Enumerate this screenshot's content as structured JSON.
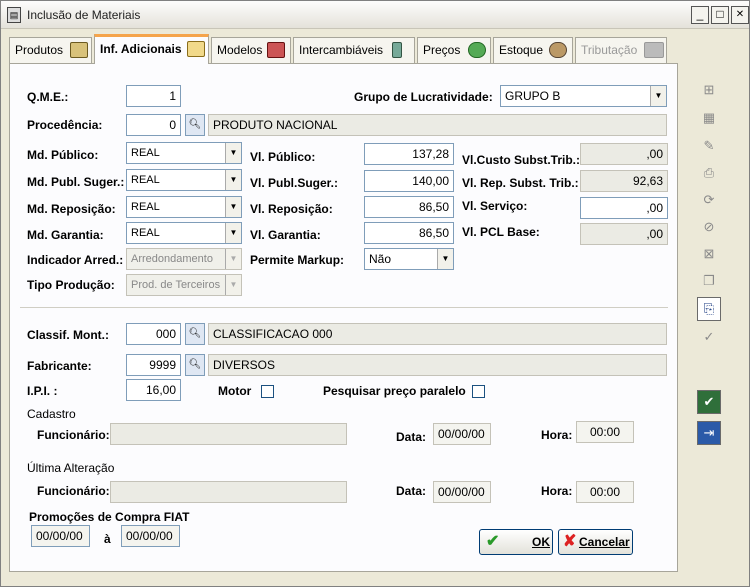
{
  "window": {
    "title": "Inclusão de Materiais",
    "minimize": "_",
    "maximize": "□",
    "close": "✕"
  },
  "tabs": [
    {
      "label": "Produtos"
    },
    {
      "label": "Inf. Adicionais"
    },
    {
      "label": "Modelos"
    },
    {
      "label": "Intercambiáveis"
    },
    {
      "label": "Preços"
    },
    {
      "label": "Estoque"
    },
    {
      "label": "Tributação"
    }
  ],
  "form": {
    "qme": {
      "label": "Q.M.E.:",
      "value": "1"
    },
    "grupo_lucratividade": {
      "label": "Grupo de Lucratividade:",
      "value": "GRUPO B"
    },
    "procedencia": {
      "label": "Procedência:",
      "code": "0",
      "desc": "PRODUTO NACIONAL"
    },
    "md_publico": {
      "label": "Md. Público:",
      "value": "REAL"
    },
    "md_publ_suger": {
      "label": "Md. Publ. Suger.:",
      "value": "REAL"
    },
    "md_reposicao": {
      "label": "Md. Reposição:",
      "value": "REAL"
    },
    "md_garantia": {
      "label": "Md. Garantia:",
      "value": "REAL"
    },
    "indicador_arred": {
      "label": "Indicador Arred.:",
      "value": "Arredondamento"
    },
    "tipo_producao": {
      "label": "Tipo Produção:",
      "value": "Prod. de Terceiros"
    },
    "vl_publico": {
      "label": "Vl. Público:",
      "value": "137,28"
    },
    "vl_publ_suger": {
      "label": "Vl. Publ.Suger.:",
      "value": "140,00"
    },
    "vl_reposicao": {
      "label": "Vl. Reposição:",
      "value": "86,50"
    },
    "vl_garantia": {
      "label": "Vl. Garantia:",
      "value": "86,50"
    },
    "permite_markup": {
      "label": "Permite Markup:",
      "value": "Não"
    },
    "vl_custo_subst": {
      "label": "Vl.Custo Subst.Trib.:",
      "value": ",00"
    },
    "vl_rep_subst": {
      "label": "Vl. Rep. Subst. Trib.:",
      "value": "92,63"
    },
    "vl_servico": {
      "label": "Vl. Serviço:",
      "value": ",00"
    },
    "vl_pcl_base": {
      "label": "Vl. PCL Base:",
      "value": ",00"
    },
    "classif_mont": {
      "label": "Classif. Mont.:",
      "code": "000",
      "desc": "CLASSIFICACAO 000"
    },
    "fabricante": {
      "label": "Fabricante:",
      "code": "9999",
      "desc": "DIVERSOS"
    },
    "ipi": {
      "label": "I.P.I. :",
      "value": "16,00"
    },
    "motor": {
      "label": "Motor"
    },
    "pesquisar_preco": {
      "label": "Pesquisar preço paralelo"
    }
  },
  "cadastro": {
    "title": "Cadastro",
    "funcionario_label": "Funcionário:",
    "funcionario": "",
    "data_label": "Data:",
    "data": "00/00/00",
    "hora_label": "Hora:",
    "hora": "00:00"
  },
  "ultima_alteracao": {
    "title": "Última Alteração",
    "funcionario_label": "Funcionário:",
    "funcionario": "",
    "data_label": "Data:",
    "data": "00/00/00",
    "hora_label": "Hora:",
    "hora": "00:00"
  },
  "promocoes": {
    "title": "Promoções de Compra FIAT",
    "de": "00/00/00",
    "sep": "à",
    "ate": "00/00/00"
  },
  "buttons": {
    "ok": "OK",
    "cancel": "Cancelar"
  },
  "colors": {
    "accent_tab": "#f5a44b",
    "field_border": "#7f9db9",
    "window_bg": "#ece9d8"
  }
}
